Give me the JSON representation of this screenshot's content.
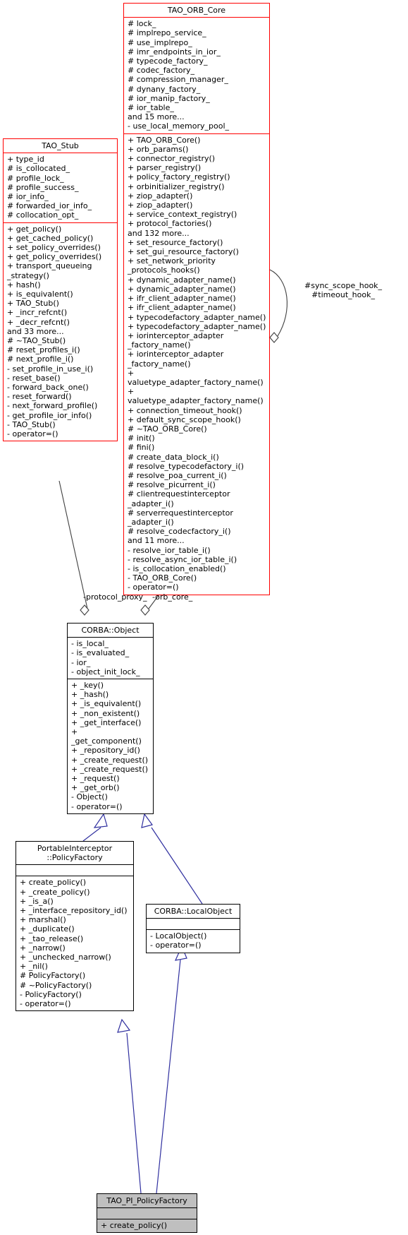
{
  "diagram": {
    "kind": "uml-class-collaboration-diagram",
    "colors": {
      "highlight_border": "#ff0000",
      "normal_border": "#000000",
      "inheritance_edge": "#2f2f9f",
      "association_edge": "#404040",
      "focus_fill": "#bfbfbf",
      "background": "#ffffff"
    }
  },
  "classes": {
    "orb_core": {
      "name": "TAO_ORB_Core",
      "attributes": [
        "# lock_",
        "# implrepo_service_",
        "# use_implrepo_",
        "# imr_endpoints_in_ior_",
        "# typecode_factory_",
        "# codec_factory_",
        "# compression_manager_",
        "# dynany_factory_",
        "# ior_manip_factory_",
        "# ior_table_",
        "and 15 more...",
        "- use_local_memory_pool_"
      ],
      "operations": [
        "+ TAO_ORB_Core()",
        "+ orb_params()",
        "+ connector_registry()",
        "+ parser_registry()",
        "+ policy_factory_registry()",
        "+ orbinitializer_registry()",
        "+ ziop_adapter()",
        "+ ziop_adapter()",
        "+ service_context_registry()",
        "+ protocol_factories()",
        "and 132 more...",
        "+ set_resource_factory()",
        "+ set_gui_resource_factory()",
        "+ set_network_priority\n_protocols_hooks()",
        "+ dynamic_adapter_name()",
        "+ dynamic_adapter_name()",
        "+ ifr_client_adapter_name()",
        "+ ifr_client_adapter_name()",
        "+ typecodefactory_adapter_name()",
        "+ typecodefactory_adapter_name()",
        "+ iorinterceptor_adapter\n_factory_name()",
        "+ iorinterceptor_adapter\n_factory_name()",
        "+ valuetype_adapter_factory_name()",
        "+ valuetype_adapter_factory_name()",
        "+ connection_timeout_hook()",
        "+ default_sync_scope_hook()",
        "# ~TAO_ORB_Core()",
        "# init()",
        "# fini()",
        "# create_data_block_i()",
        "# resolve_typecodefactory_i()",
        "# resolve_poa_current_i()",
        "# resolve_picurrent_i()",
        "# clientrequestinterceptor\n_adapter_i()",
        "# serverrequestinterceptor\n_adapter_i()",
        "# resolve_codecfactory_i()",
        "and 11 more...",
        "- resolve_ior_table_i()",
        "- resolve_async_ior_table_i()",
        "- is_collocation_enabled()",
        "- TAO_ORB_Core()",
        "- operator=()"
      ]
    },
    "stub": {
      "name": "TAO_Stub",
      "attributes": [
        "+ type_id",
        "# is_collocated_",
        "# profile_lock_",
        "# profile_success_",
        "# ior_info_",
        "# forwarded_ior_info_",
        "# collocation_opt_"
      ],
      "operations": [
        "+ get_policy()",
        "+ get_cached_policy()",
        "+ set_policy_overrides()",
        "+ get_policy_overrides()",
        "+ transport_queueing\n_strategy()",
        "+ hash()",
        "+ is_equivalent()",
        "+ TAO_Stub()",
        "+ _incr_refcnt()",
        "+ _decr_refcnt()",
        "and 33 more...",
        "# ~TAO_Stub()",
        "# reset_profiles_i()",
        "# next_profile_i()",
        "- set_profile_in_use_i()",
        "- reset_base()",
        "- forward_back_one()",
        "- reset_forward()",
        "- next_forward_profile()",
        "- get_profile_ior_info()",
        "- TAO_Stub()",
        "- operator=()"
      ]
    },
    "object": {
      "name": "CORBA::Object",
      "attributes": [
        "- is_local_",
        "- is_evaluated_",
        "- ior_",
        "- object_init_lock_"
      ],
      "operations": [
        "+ _key()",
        "+ _hash()",
        "+ _is_equivalent()",
        "+ _non_existent()",
        "+ _get_interface()",
        "+ _get_component()",
        "+ _repository_id()",
        "+ _create_request()",
        "+ _create_request()",
        "+ _request()",
        "+ _get_orb()",
        "- Object()",
        "- operator=()"
      ]
    },
    "policy_factory": {
      "name": "PortableInterceptor\n::PolicyFactory",
      "attributes": [],
      "operations": [
        "+ create_policy()",
        "+ _create_policy()",
        "+ _is_a()",
        "+ _interface_repository_id()",
        "+ marshal()",
        "+ _duplicate()",
        "+ _tao_release()",
        "+ _narrow()",
        "+ _unchecked_narrow()",
        "+ _nil()",
        "# PolicyFactory()",
        "# ~PolicyFactory()",
        "- PolicyFactory()",
        "- operator=()"
      ]
    },
    "local_object": {
      "name": "CORBA::LocalObject",
      "attributes": [],
      "operations": [
        "- LocalObject()",
        "- operator=()"
      ]
    },
    "tao_pi_policy_factory": {
      "name": "TAO_PI_PolicyFactory",
      "attributes": [],
      "operations": [
        "+ create_policy()"
      ]
    }
  },
  "edges": [
    {
      "id": "stub-object",
      "label": "-protocol_proxy_",
      "from": "stub",
      "to": "object",
      "type": "aggregation"
    },
    {
      "id": "orbcore-object",
      "label": "-orb_core_",
      "from": "orb_core",
      "to": "object",
      "type": "aggregation"
    },
    {
      "id": "orbcore-self",
      "label": "#sync_scope_hook_\n#timeout_hook_",
      "from": "orb_core",
      "to": "orb_core",
      "type": "self-aggregation"
    },
    {
      "id": "object-policyfactory",
      "label": "",
      "from": "object",
      "to": "policy_factory",
      "type": "inheritance"
    },
    {
      "id": "object-localobject",
      "label": "",
      "from": "object",
      "to": "local_object",
      "type": "inheritance"
    },
    {
      "id": "polfac-taopi",
      "label": "",
      "from": "policy_factory",
      "to": "tao_pi_policy_factory",
      "type": "inheritance"
    },
    {
      "id": "localobj-taopi",
      "label": "",
      "from": "local_object",
      "to": "tao_pi_policy_factory",
      "type": "inheritance"
    }
  ]
}
